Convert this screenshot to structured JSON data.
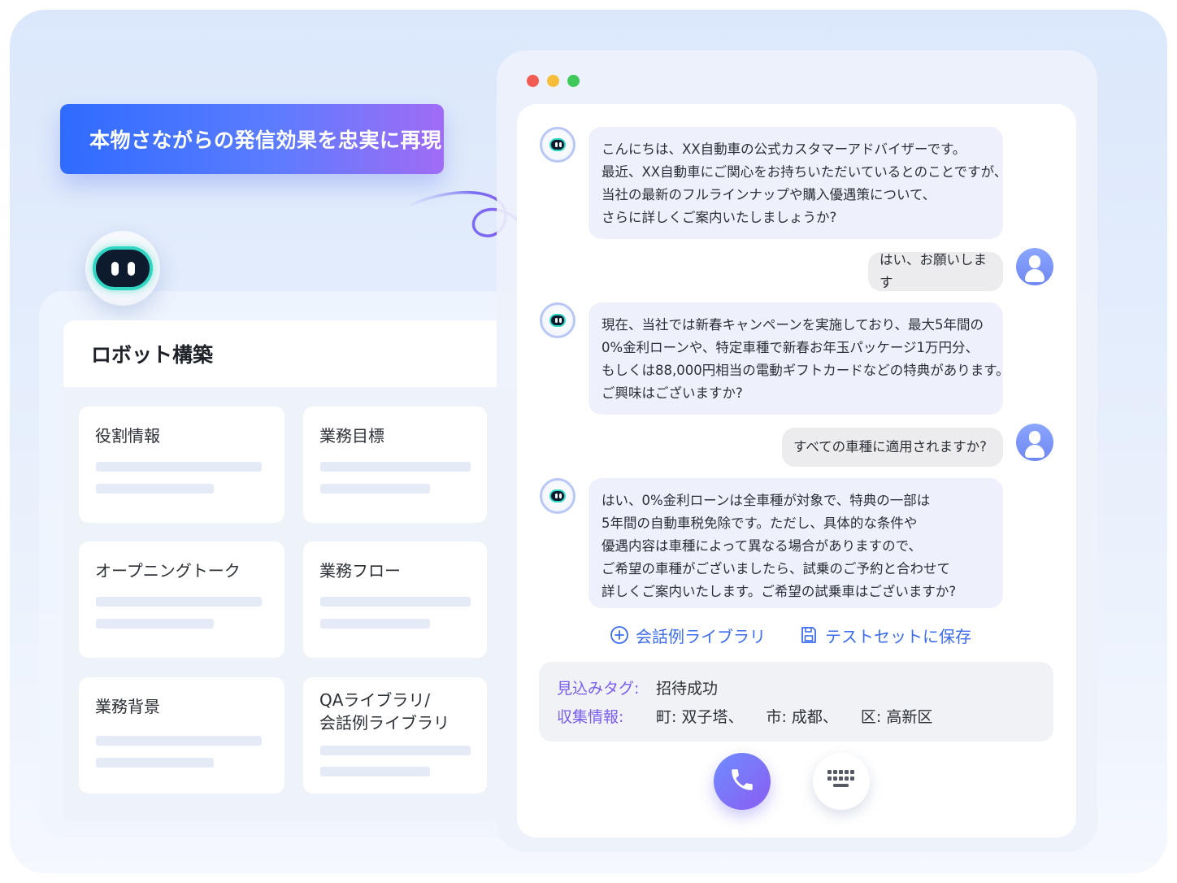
{
  "headline": "本物さながらの発信効果を忠実に再現",
  "builder": {
    "title": "ロボット構築",
    "cards": [
      {
        "label": "役割情報"
      },
      {
        "label": "業務目標"
      },
      {
        "label": "オープニングトーク"
      },
      {
        "label": "業務フロー"
      },
      {
        "label": "業務背景"
      },
      {
        "label": "QAライブラリ/\n会話例ライブラリ"
      }
    ]
  },
  "chat": {
    "window_controls": [
      "#f25c54",
      "#f6bd3a",
      "#3fc95a"
    ],
    "messages": [
      {
        "role": "bot",
        "lines": [
          "こんにちは、XX自動車の公式カスタマーアドバイザーです。",
          "最近、XX自動車にご関心をお持ちいただいているとのことですが、",
          "当社の最新のフルラインナップや購入優遇策について、",
          "さらに詳しくご案内いたしましょうか?"
        ]
      },
      {
        "role": "user",
        "text": "はい、お願いします"
      },
      {
        "role": "bot",
        "lines": [
          "現在、当社では新春キャンペーンを実施しており、最大5年間の",
          "0%金利ローンや、特定車種で新春お年玉パッケージ1万円分、",
          "もしくは88,000円相当の電動ギフトカードなどの特典があります。",
          "ご興味はございますか?"
        ]
      },
      {
        "role": "user",
        "text": "すべての車種に適用されますか?"
      },
      {
        "role": "bot",
        "lines": [
          "はい、0%金利ローンは全車種が対象で、特典の一部は",
          "5年間の自動車税免除です。ただし、具体的な条件や",
          "優遇内容は車種によって異なる場合がありますので、",
          "ご希望の車種がございましたら、試乗のご予約と合わせて",
          "詳しくご案内いたします。ご希望の試乗車はございますか?"
        ]
      }
    ],
    "actions": {
      "library": "会話例ライブラリ",
      "save": "テストセットに保存"
    },
    "tags": {
      "prospect_label": "見込みタグ:",
      "prospect_value": "招待成功",
      "collected_label": "収集情報:",
      "town": "町: 双子塔、",
      "city": "市: 成都、",
      "district": "区: 高新区"
    },
    "accent_color": "#3c6cf0",
    "tag_label_color": "#7a5cf0"
  },
  "icons": [
    "robot-avatar-icon",
    "user-avatar-icon",
    "plus-circle-icon",
    "save-icon",
    "phone-icon",
    "keypad-icon"
  ]
}
